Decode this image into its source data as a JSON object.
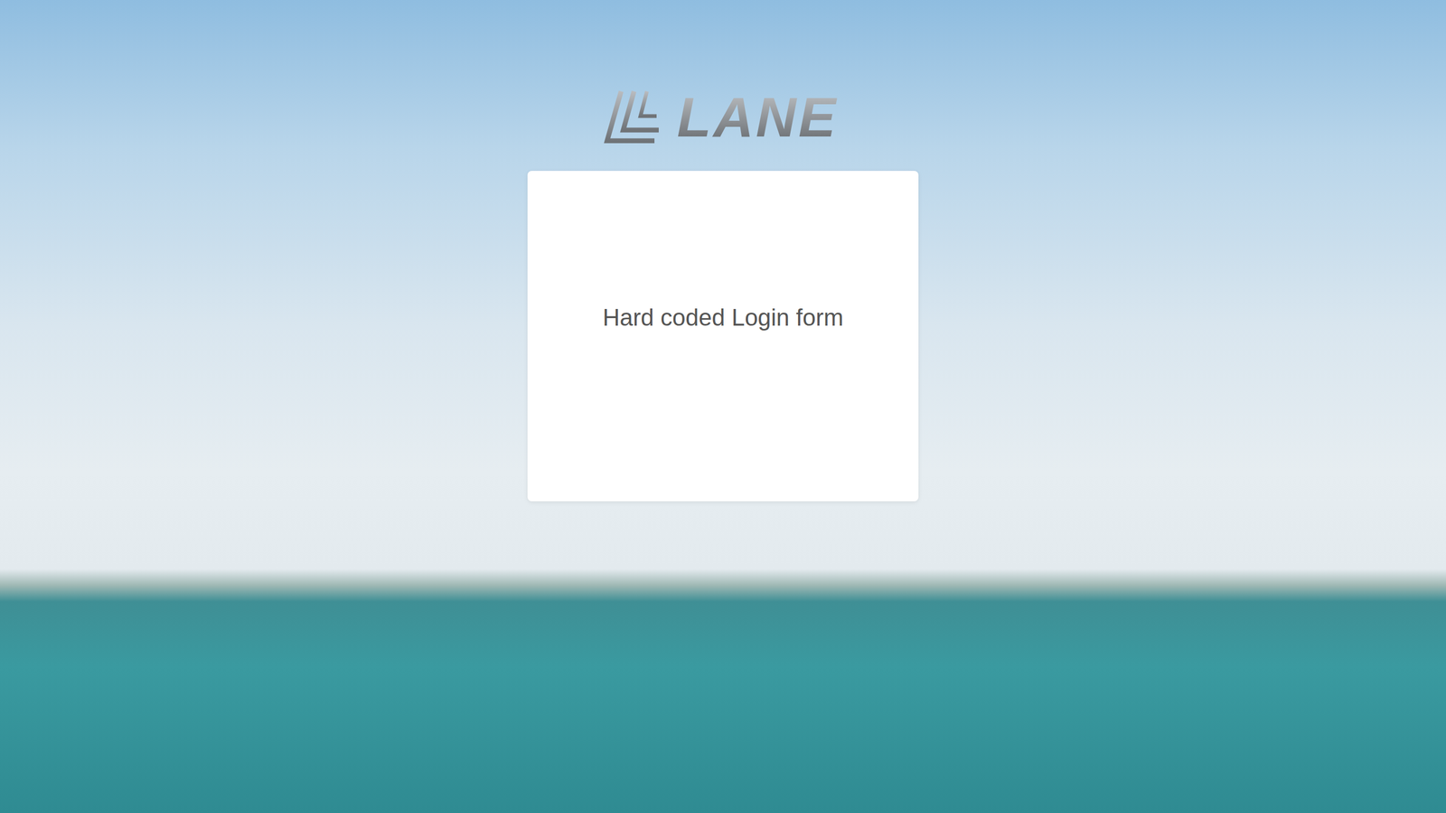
{
  "logo": {
    "text": "LANE"
  },
  "login_card": {
    "text": "Hard coded Login form"
  }
}
